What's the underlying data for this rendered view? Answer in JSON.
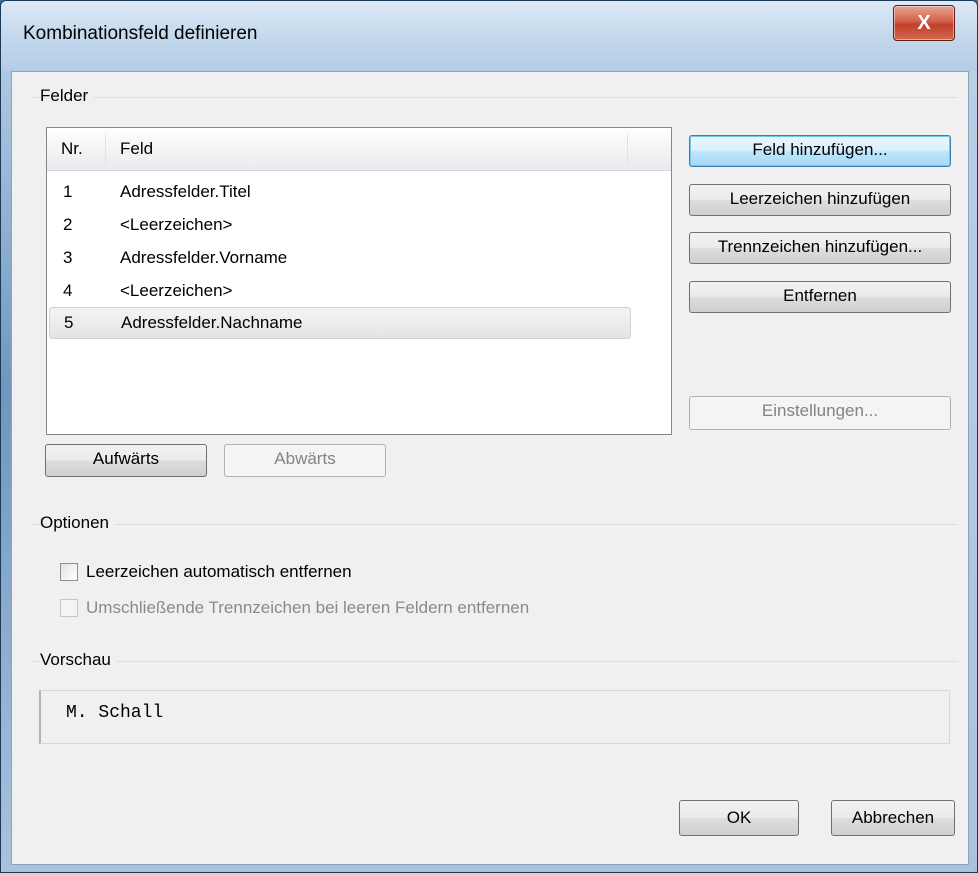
{
  "window": {
    "title": "Kombinationsfeld definieren",
    "close_glyph": "X"
  },
  "felder": {
    "group_label": "Felder",
    "columns": {
      "nr": "Nr.",
      "feld": "Feld"
    },
    "rows": [
      {
        "nr": "1",
        "feld": "Adressfelder.Titel"
      },
      {
        "nr": "2",
        "feld": "<Leerzeichen>"
      },
      {
        "nr": "3",
        "feld": "Adressfelder.Vorname"
      },
      {
        "nr": "4",
        "feld": "<Leerzeichen>"
      },
      {
        "nr": "5",
        "feld": "Adressfelder.Nachname"
      }
    ],
    "selected_row": "5"
  },
  "buttons": {
    "feld_hinzufuegen": "Feld hinzufügen...",
    "leerzeichen_hinzufuegen": "Leerzeichen hinzufügen",
    "trennzeichen_hinzufuegen": "Trennzeichen hinzufügen...",
    "entfernen": "Entfernen",
    "einstellungen": "Einstellungen...",
    "aufwaerts": "Aufwärts",
    "abwaerts": "Abwärts",
    "ok": "OK",
    "abbrechen": "Abbrechen"
  },
  "optionen": {
    "group_label": "Optionen",
    "leerzeichen_auto": {
      "label": "Leerzeichen automatisch entfernen",
      "checked": false,
      "enabled": true
    },
    "trennzeichen_leer": {
      "label": "Umschließende Trennzeichen bei leeren Feldern entfernen",
      "checked": false,
      "enabled": false
    }
  },
  "vorschau": {
    "group_label": "Vorschau",
    "text": "M. Schall"
  }
}
